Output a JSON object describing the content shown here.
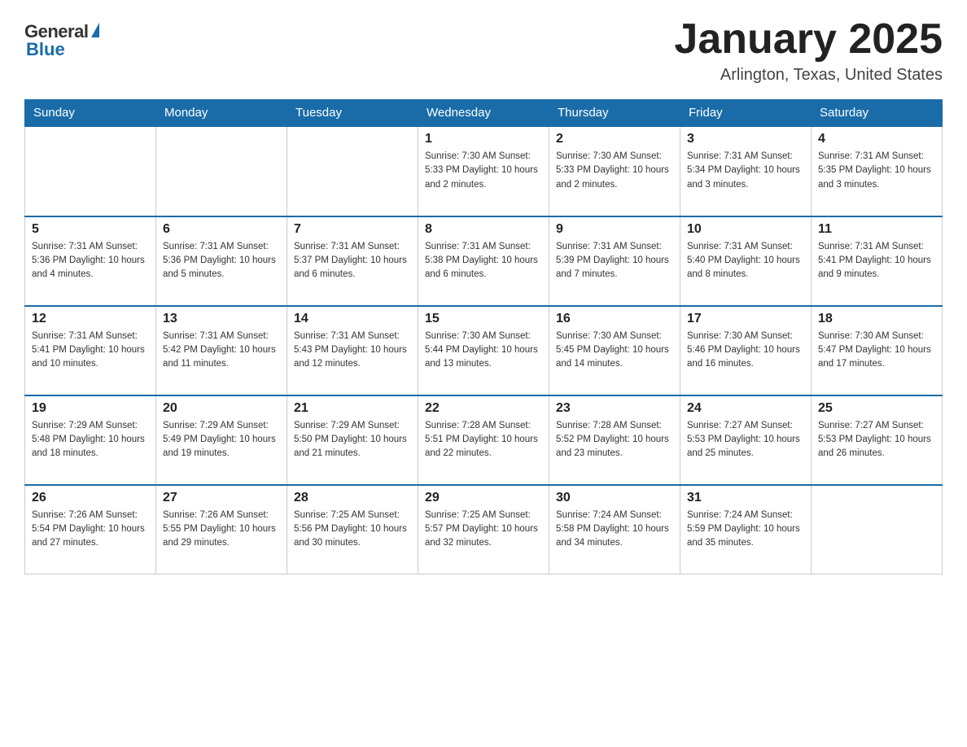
{
  "header": {
    "logo_general": "General",
    "logo_blue": "Blue",
    "month_title": "January 2025",
    "location": "Arlington, Texas, United States"
  },
  "days_of_week": [
    "Sunday",
    "Monday",
    "Tuesday",
    "Wednesday",
    "Thursday",
    "Friday",
    "Saturday"
  ],
  "weeks": [
    [
      {
        "day": "",
        "info": ""
      },
      {
        "day": "",
        "info": ""
      },
      {
        "day": "",
        "info": ""
      },
      {
        "day": "1",
        "info": "Sunrise: 7:30 AM\nSunset: 5:33 PM\nDaylight: 10 hours\nand 2 minutes."
      },
      {
        "day": "2",
        "info": "Sunrise: 7:30 AM\nSunset: 5:33 PM\nDaylight: 10 hours\nand 2 minutes."
      },
      {
        "day": "3",
        "info": "Sunrise: 7:31 AM\nSunset: 5:34 PM\nDaylight: 10 hours\nand 3 minutes."
      },
      {
        "day": "4",
        "info": "Sunrise: 7:31 AM\nSunset: 5:35 PM\nDaylight: 10 hours\nand 3 minutes."
      }
    ],
    [
      {
        "day": "5",
        "info": "Sunrise: 7:31 AM\nSunset: 5:36 PM\nDaylight: 10 hours\nand 4 minutes."
      },
      {
        "day": "6",
        "info": "Sunrise: 7:31 AM\nSunset: 5:36 PM\nDaylight: 10 hours\nand 5 minutes."
      },
      {
        "day": "7",
        "info": "Sunrise: 7:31 AM\nSunset: 5:37 PM\nDaylight: 10 hours\nand 6 minutes."
      },
      {
        "day": "8",
        "info": "Sunrise: 7:31 AM\nSunset: 5:38 PM\nDaylight: 10 hours\nand 6 minutes."
      },
      {
        "day": "9",
        "info": "Sunrise: 7:31 AM\nSunset: 5:39 PM\nDaylight: 10 hours\nand 7 minutes."
      },
      {
        "day": "10",
        "info": "Sunrise: 7:31 AM\nSunset: 5:40 PM\nDaylight: 10 hours\nand 8 minutes."
      },
      {
        "day": "11",
        "info": "Sunrise: 7:31 AM\nSunset: 5:41 PM\nDaylight: 10 hours\nand 9 minutes."
      }
    ],
    [
      {
        "day": "12",
        "info": "Sunrise: 7:31 AM\nSunset: 5:41 PM\nDaylight: 10 hours\nand 10 minutes."
      },
      {
        "day": "13",
        "info": "Sunrise: 7:31 AM\nSunset: 5:42 PM\nDaylight: 10 hours\nand 11 minutes."
      },
      {
        "day": "14",
        "info": "Sunrise: 7:31 AM\nSunset: 5:43 PM\nDaylight: 10 hours\nand 12 minutes."
      },
      {
        "day": "15",
        "info": "Sunrise: 7:30 AM\nSunset: 5:44 PM\nDaylight: 10 hours\nand 13 minutes."
      },
      {
        "day": "16",
        "info": "Sunrise: 7:30 AM\nSunset: 5:45 PM\nDaylight: 10 hours\nand 14 minutes."
      },
      {
        "day": "17",
        "info": "Sunrise: 7:30 AM\nSunset: 5:46 PM\nDaylight: 10 hours\nand 16 minutes."
      },
      {
        "day": "18",
        "info": "Sunrise: 7:30 AM\nSunset: 5:47 PM\nDaylight: 10 hours\nand 17 minutes."
      }
    ],
    [
      {
        "day": "19",
        "info": "Sunrise: 7:29 AM\nSunset: 5:48 PM\nDaylight: 10 hours\nand 18 minutes."
      },
      {
        "day": "20",
        "info": "Sunrise: 7:29 AM\nSunset: 5:49 PM\nDaylight: 10 hours\nand 19 minutes."
      },
      {
        "day": "21",
        "info": "Sunrise: 7:29 AM\nSunset: 5:50 PM\nDaylight: 10 hours\nand 21 minutes."
      },
      {
        "day": "22",
        "info": "Sunrise: 7:28 AM\nSunset: 5:51 PM\nDaylight: 10 hours\nand 22 minutes."
      },
      {
        "day": "23",
        "info": "Sunrise: 7:28 AM\nSunset: 5:52 PM\nDaylight: 10 hours\nand 23 minutes."
      },
      {
        "day": "24",
        "info": "Sunrise: 7:27 AM\nSunset: 5:53 PM\nDaylight: 10 hours\nand 25 minutes."
      },
      {
        "day": "25",
        "info": "Sunrise: 7:27 AM\nSunset: 5:53 PM\nDaylight: 10 hours\nand 26 minutes."
      }
    ],
    [
      {
        "day": "26",
        "info": "Sunrise: 7:26 AM\nSunset: 5:54 PM\nDaylight: 10 hours\nand 27 minutes."
      },
      {
        "day": "27",
        "info": "Sunrise: 7:26 AM\nSunset: 5:55 PM\nDaylight: 10 hours\nand 29 minutes."
      },
      {
        "day": "28",
        "info": "Sunrise: 7:25 AM\nSunset: 5:56 PM\nDaylight: 10 hours\nand 30 minutes."
      },
      {
        "day": "29",
        "info": "Sunrise: 7:25 AM\nSunset: 5:57 PM\nDaylight: 10 hours\nand 32 minutes."
      },
      {
        "day": "30",
        "info": "Sunrise: 7:24 AM\nSunset: 5:58 PM\nDaylight: 10 hours\nand 34 minutes."
      },
      {
        "day": "31",
        "info": "Sunrise: 7:24 AM\nSunset: 5:59 PM\nDaylight: 10 hours\nand 35 minutes."
      },
      {
        "day": "",
        "info": ""
      }
    ]
  ]
}
